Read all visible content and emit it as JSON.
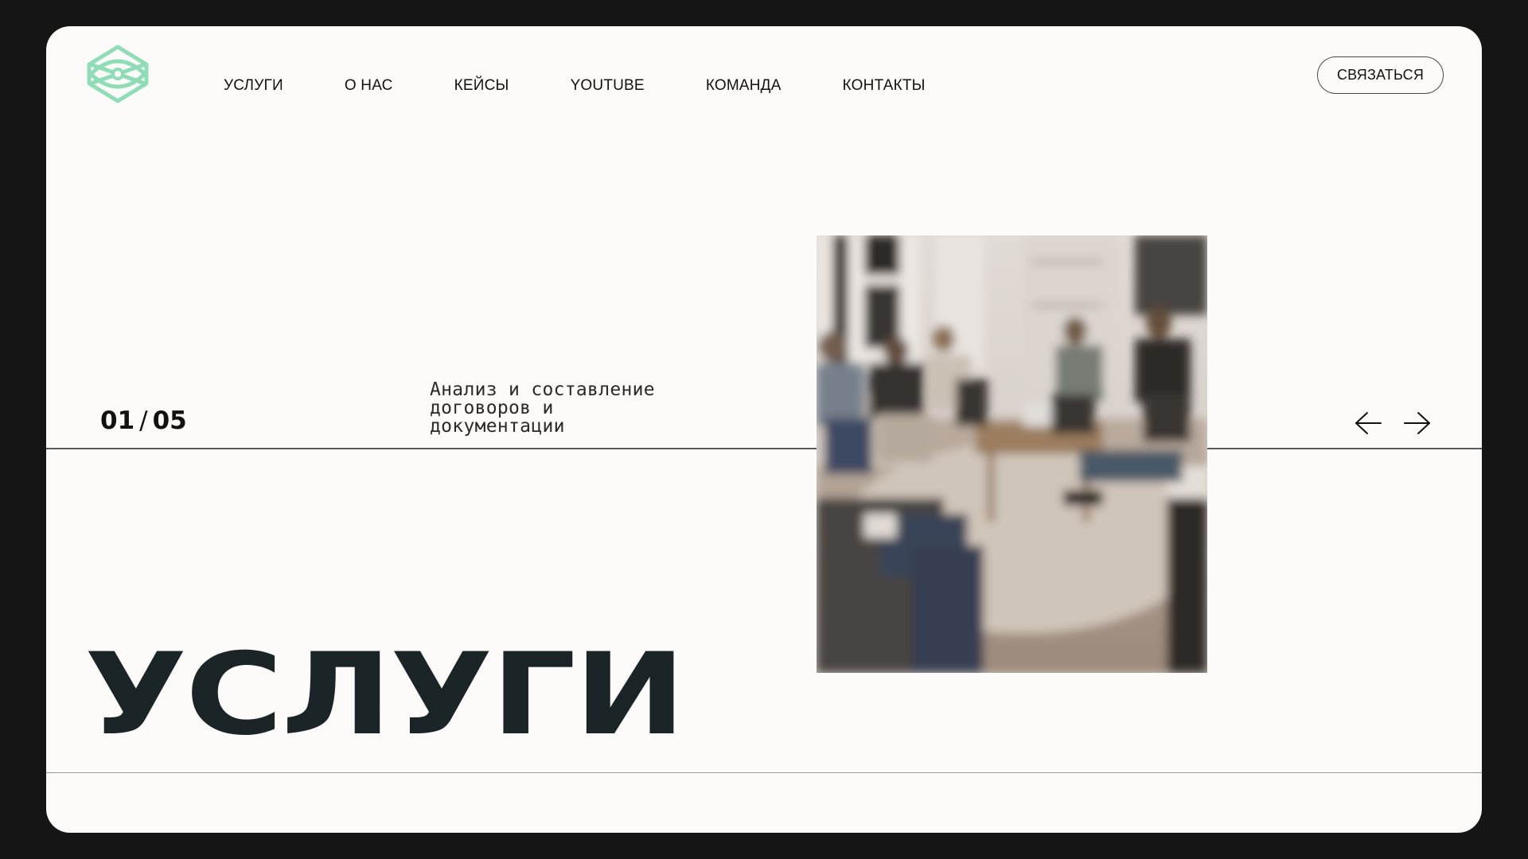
{
  "nav": {
    "items": [
      {
        "label": "УСЛУГИ"
      },
      {
        "label": "О НАС"
      },
      {
        "label": "КЕЙСЫ"
      },
      {
        "label": "YOUTUBE"
      },
      {
        "label": "КОМАНДА"
      },
      {
        "label": "КОНТАКТЫ"
      }
    ]
  },
  "header": {
    "cta_label": "СВЯЗАТЬСЯ",
    "logo_icon": "eye-hexagon-logo-icon"
  },
  "slider": {
    "current": "01",
    "separator": "/",
    "total": "05",
    "description": "Анализ и составление договоров и документации",
    "prev_icon": "arrow-left-icon",
    "next_icon": "arrow-right-icon"
  },
  "hero": {
    "title": "УСЛУГИ"
  },
  "colors": {
    "page_background": "#151515",
    "card_background": "#fcfbf9",
    "logo_accent": "#8fdcb7",
    "title_color": "#1b2528"
  }
}
